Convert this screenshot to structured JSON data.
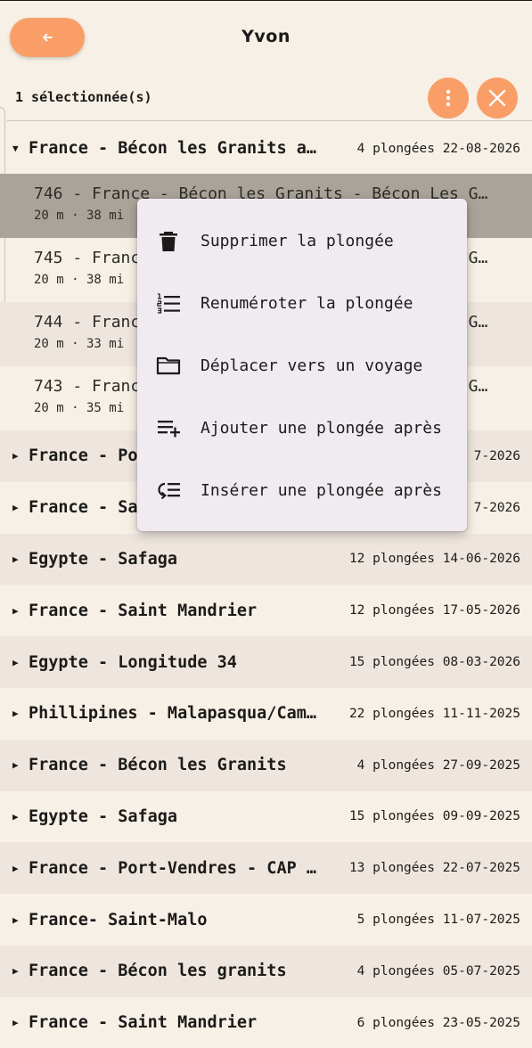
{
  "header": {
    "title": "Yvon"
  },
  "selection": {
    "count_label": "1 sélectionnée(s)"
  },
  "expanded_trip": {
    "name": "France - Bécon les Granits a…",
    "meta": "4 plongées 22-08-2026",
    "dives": [
      {
        "title": "746 - France - Bécon les Granits - Bécon Les G…",
        "sub": "20 m · 38 mi",
        "selected": true
      },
      {
        "title": "745 - France - Bécon les Granits - Bécon Les G…",
        "sub": "20 m · 38 mi",
        "selected": false
      },
      {
        "title": "744 - France - Bécon les Granits - Bécon Les G…",
        "sub": "20 m · 33 mi",
        "selected": false
      },
      {
        "title": "743 - France - Bécon les Granits - Bécon Les G…",
        "sub": "20 m · 35 mi",
        "selected": false
      }
    ]
  },
  "trips": [
    {
      "name": "France - Por",
      "meta": "7-2026"
    },
    {
      "name": "France - Sa",
      "meta": "7-2026"
    },
    {
      "name": "Egypte - Safaga",
      "meta": "12 plongées 14-06-2026"
    },
    {
      "name": "France - Saint Mandrier",
      "meta": "12 plongées 17-05-2026"
    },
    {
      "name": "Egypte - Longitude 34",
      "meta": "15 plongées 08-03-2026"
    },
    {
      "name": "Phillipines - Malapasqua/Cam…",
      "meta": "22 plongées 11-11-2025"
    },
    {
      "name": "France - Bécon les Granits",
      "meta": "4 plongées 27-09-2025"
    },
    {
      "name": "Egypte - Safaga",
      "meta": "15 plongées 09-09-2025"
    },
    {
      "name": "France - Port-Vendres - CAP …",
      "meta": "13 plongées 22-07-2025"
    },
    {
      "name": "France- Saint-Malo",
      "meta": "5 plongées 11-07-2025"
    },
    {
      "name": "France - Bécon les granits",
      "meta": "4 plongées 05-07-2025"
    },
    {
      "name": "France - Saint Mandrier",
      "meta": "6 plongées 23-05-2025"
    }
  ],
  "menu": {
    "items": [
      {
        "label": "Supprimer la plongée",
        "icon": "trash-icon"
      },
      {
        "label": "Renuméroter la plongée",
        "icon": "numbered-list-icon"
      },
      {
        "label": "Déplacer vers un voyage",
        "icon": "folder-icon"
      },
      {
        "label": "Ajouter une plongée après",
        "icon": "playlist-add-icon"
      },
      {
        "label": "Insérer une plongée après",
        "icon": "insert-list-icon"
      }
    ]
  },
  "colors": {
    "accent": "#f99e66",
    "background": "#f6f0e6",
    "row_alt": "#eee6de",
    "selected_row": "#aaa39a",
    "menu_bg": "#efebf1"
  }
}
